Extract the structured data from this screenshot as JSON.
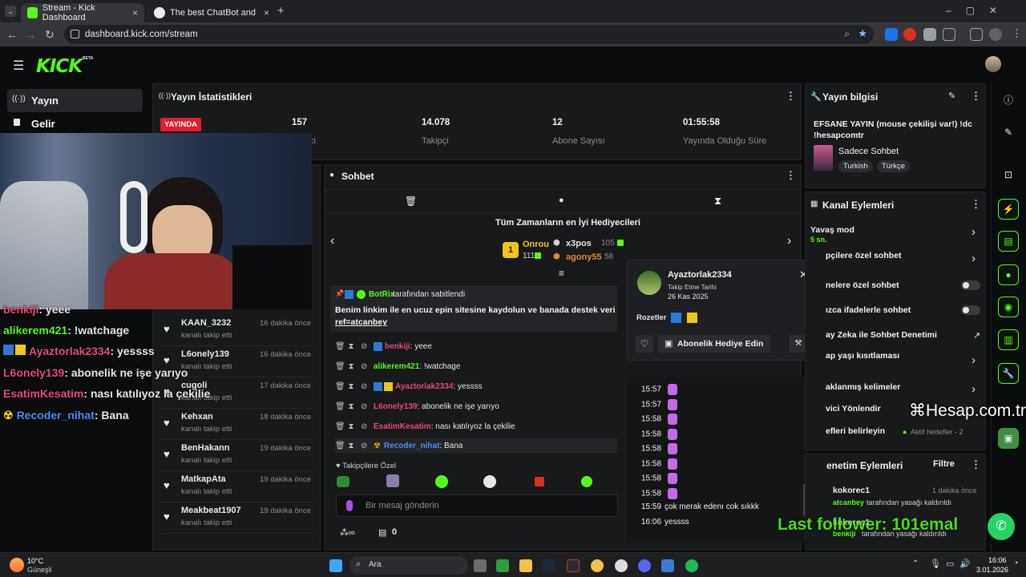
{
  "browser": {
    "tabs": [
      {
        "title": "Stream - Kick Dashboard",
        "active": true
      },
      {
        "title": "The best ChatBot and Widg",
        "active": false
      }
    ],
    "new_tab": "+",
    "url": "dashboard.kick.com/stream"
  },
  "kick": {
    "logo": "KICK",
    "logo_beta": "BETA"
  },
  "sidebar": {
    "items": [
      {
        "label": "Yayın",
        "icon": "broadcast-icon"
      },
      {
        "label": "Gelir",
        "icon": "income-icon"
      }
    ]
  },
  "stats": {
    "title": "Yayın İstatistikleri",
    "live_badge": "YAYINDA",
    "items": [
      {
        "value": "157",
        "label": "ci"
      },
      {
        "value": "14.078",
        "label": "Takipçi"
      },
      {
        "value": "12",
        "label": "Abone Sayısı"
      },
      {
        "value": "01:55:58",
        "label": "Yayında Olduğu Süre"
      }
    ]
  },
  "stream_info": {
    "title": "Yayın bilgisi",
    "stream_title": "EFSANE YAYIN (mouse çekilişi var!) !dc !hesapcomtr",
    "category": "Sadece Sohbet",
    "tags": [
      "Turkish",
      "Türkçe"
    ]
  },
  "chat": {
    "title": "Sohbet",
    "gifters_title": "Tüm Zamanların en İyi Hediyecileri",
    "gifters": [
      {
        "rank": "1",
        "name": "Onrou",
        "count": "111"
      },
      {
        "rank": "",
        "name": "x3pos",
        "count": "105"
      },
      {
        "rank": "",
        "name": "agony55",
        "count": "58"
      }
    ],
    "pinned_by": "BotRix",
    "pinned_suffix": "tarafından sabitlendi",
    "pinned_text": "Benim linkim ile en ucuz epin sitesine kaydolun ve banada destek verin",
    "pinned_link": "ref=atcanbey",
    "messages": [
      {
        "user": "benkiji",
        "text": ": yeee",
        "color": "#e64a7a"
      },
      {
        "user": "alikerem421",
        "text": ": !watchage",
        "color": "#53fc18"
      },
      {
        "user": "Ayaztorlak2334",
        "text": ": yessss",
        "color": "#e64a7a"
      },
      {
        "user": "L6onely139",
        "text": ": abonelik ne işe yarıyo",
        "color": "#e64a7a"
      },
      {
        "user": "EsatimKesatim",
        "text": ": nası katılıyoz la çekilie",
        "color": "#e64a7a"
      },
      {
        "user": "Recoder_nihat",
        "text": ": Bana",
        "color": "#4a8cff"
      }
    ],
    "followers_only": "Takipçilere Özel",
    "input_placeholder": "Bir mesaj gönderin",
    "footer_count": "0"
  },
  "followers_list": [
    {
      "name": "KAAN_3232",
      "sub": "kanalı takip etti",
      "time": "16 dakika önce"
    },
    {
      "name": "L6onely139",
      "sub": "kanalı takip etti",
      "time": "16 dakika önce"
    },
    {
      "name": "cugoli",
      "sub": "kanalı takip etti",
      "time": "17 dakika önce"
    },
    {
      "name": "Kehxan",
      "sub": "kanalı takip etti",
      "time": "18 dakika önce"
    },
    {
      "name": "BenHakann",
      "sub": "kanalı takip etti",
      "time": "19 dakika önce"
    },
    {
      "name": "MatkapAta",
      "sub": "kanalı takip etti",
      "time": "19 dakika önce"
    },
    {
      "name": "Meakbeat1907",
      "sub": "kanalı takip etti",
      "time": "19 dakika önce"
    }
  ],
  "user_card": {
    "name": "Ayaztorlak2334",
    "follow_label": "Takip Etme Tarihi",
    "follow_date": "26 Kas 2025",
    "badges_label": "Rozetler",
    "gift_button": "Abonelik Hediye Edin",
    "history": [
      {
        "time": "15:57",
        "text": ""
      },
      {
        "time": "15:57",
        "text": ""
      },
      {
        "time": "15:58",
        "text": ""
      },
      {
        "time": "15:58",
        "text": ""
      },
      {
        "time": "15:58",
        "text": ""
      },
      {
        "time": "15:58",
        "text": ""
      },
      {
        "time": "15:58",
        "text": ""
      },
      {
        "time": "15:58",
        "text": ""
      },
      {
        "time": "15:59",
        "text": "çok merak edenı cok sıkkk"
      },
      {
        "time": "16:06",
        "text": "yessss"
      }
    ]
  },
  "channel_actions": {
    "title": "Kanal Eylemleri",
    "items": [
      {
        "label": "Yavaş mod",
        "sub": "5 sn."
      },
      {
        "label": "pçilere özel sohbet",
        "sub": ""
      },
      {
        "label": "nelere özel sohbet",
        "sub": ""
      },
      {
        "label": "ızca ifadelerle sohbet",
        "sub": ""
      },
      {
        "label": "ay Zeka ile Sohbet Denetimi",
        "sub": ""
      },
      {
        "label": "ap yaşı kısıtlaması",
        "sub": ""
      },
      {
        "label": "aklanmış kelimeler",
        "sub": ""
      },
      {
        "label": "vici Yönlendir",
        "sub": ""
      },
      {
        "label": "efleri belirleyin",
        "sub": ""
      }
    ],
    "goals_status": "Aktif hedefler - 2"
  },
  "mod_actions": {
    "title": "enetim Eylemleri",
    "filter": "Filtre",
    "items": [
      {
        "user": "kokorec1",
        "time": "1 dakika önce",
        "by": "atcanbey",
        "action": "tarafından yasağı kaldırıldı"
      },
      {
        "user": "kokorec1",
        "time": "",
        "by": "benkiji",
        "action": "tarafından yasağı kaldırıldı"
      }
    ]
  },
  "overlay": {
    "chat": [
      {
        "user": "benkiji",
        "text": ": yeee",
        "color": "#e64a7a"
      },
      {
        "user": "alikerem421",
        "text": ": !watchage",
        "color": "#53fc18"
      },
      {
        "user": "Ayaztorlak2334",
        "text": ": yessss",
        "color": "#e64a7a"
      },
      {
        "user": "L6onely139",
        "text": ": abonelik ne işe yarıyo",
        "color": "#e64a7a"
      },
      {
        "user": "EsatimKesatim",
        "text": ": nası katılıyoz la çekilie",
        "color": "#e64a7a"
      },
      {
        "user": "Recoder_nihat",
        "text": ": Bana",
        "color": "#4a8cff"
      }
    ],
    "last_follower": "Last follower: 101emal",
    "watermark": "Hesap.com.tr"
  },
  "taskbar": {
    "weather_temp": "10°C",
    "weather_desc": "Güneşli",
    "search": "Ara",
    "time": "16:06",
    "date": "3.01.2026"
  },
  "colors": {
    "accent": "#53fc18",
    "live": "#e11d2f",
    "panel": "#18191b"
  }
}
